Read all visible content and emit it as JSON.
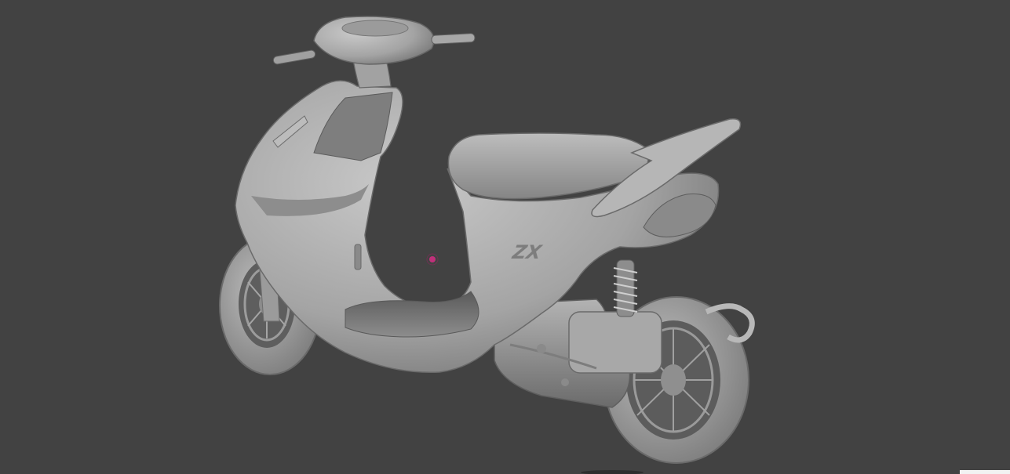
{
  "viewport": {
    "background_color": "#424242",
    "model_color": "#a9a9a9",
    "pivot_color": "#c0307a"
  },
  "model": {
    "icon": "scooter-model",
    "badge_text": "ZX"
  }
}
